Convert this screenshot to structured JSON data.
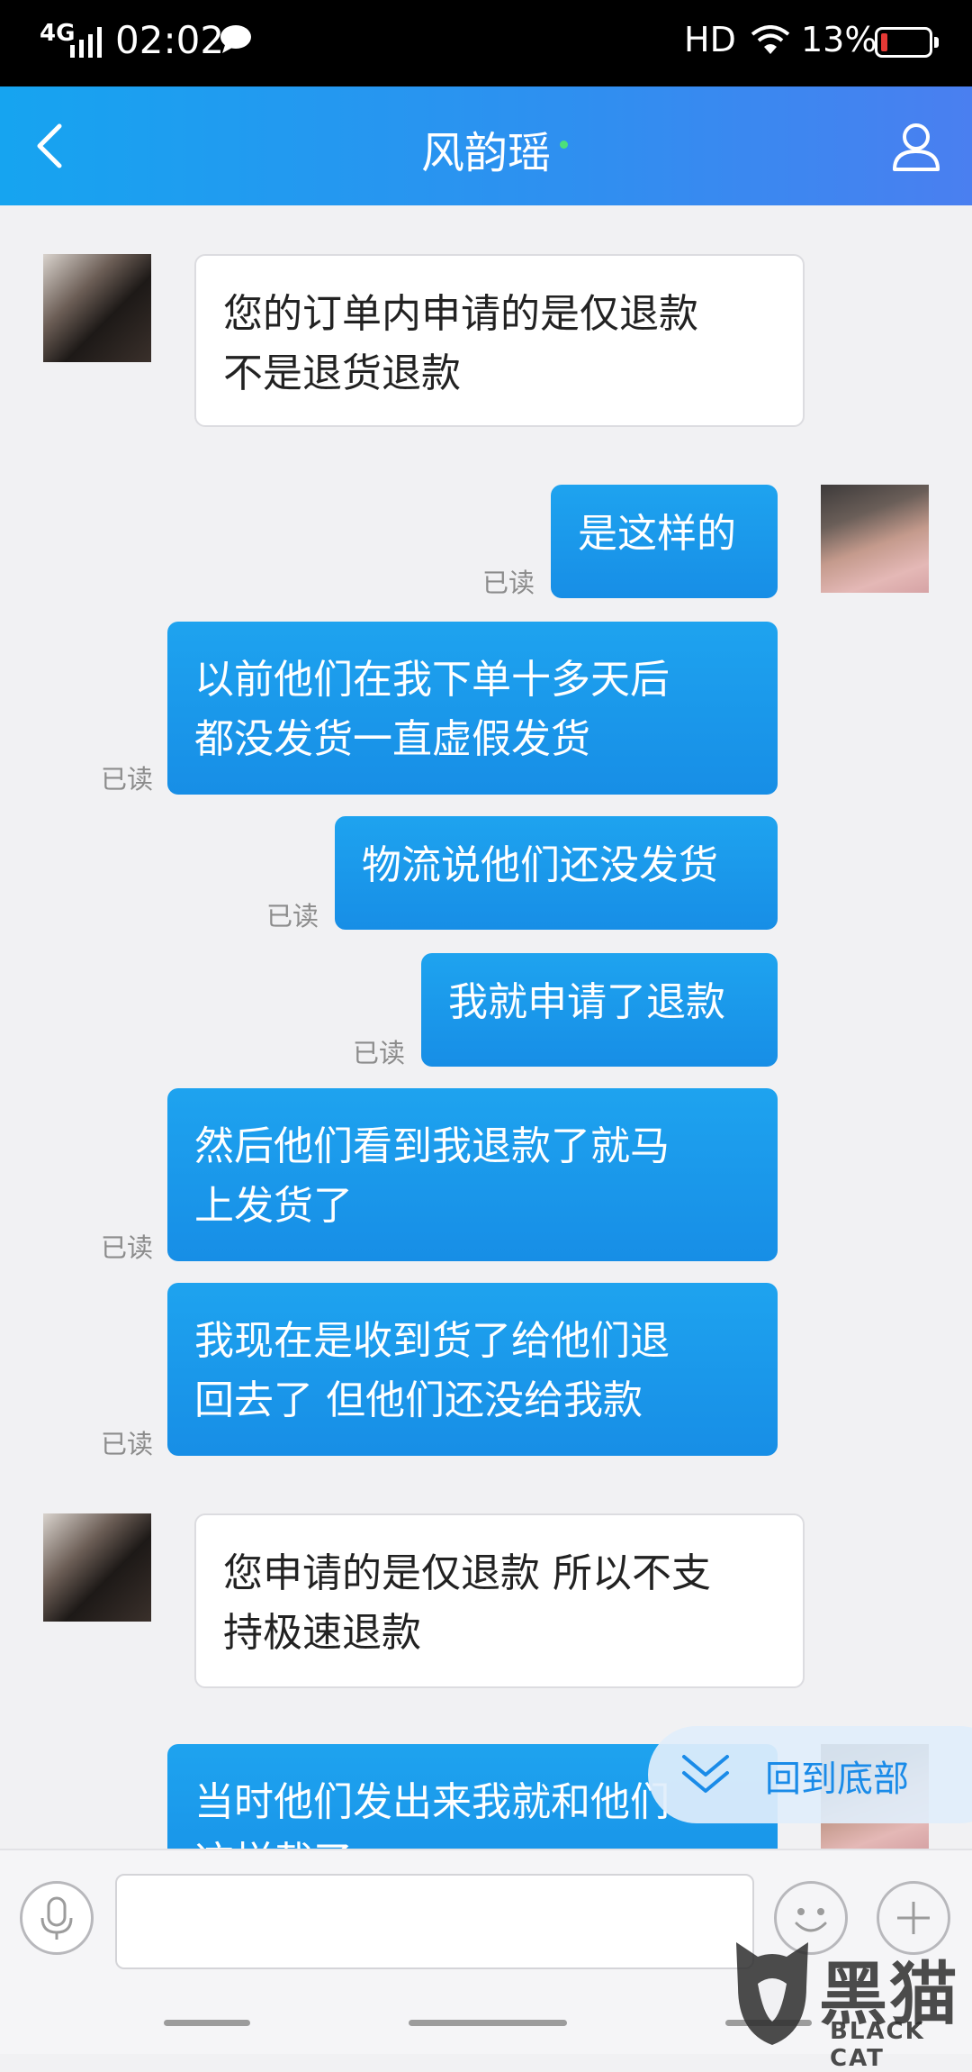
{
  "status_bar": {
    "network": "4G",
    "time": "02:02",
    "hd": "HD",
    "battery_text": "13%",
    "battery_level": 0.13
  },
  "header": {
    "title": "风韵瑶"
  },
  "messages": [
    {
      "side": "in",
      "text_line1": "您的订单内申请的是仅退款",
      "text_line2": "不是退货退款"
    },
    {
      "side": "out",
      "text": "是这样的",
      "read": "已读"
    },
    {
      "side": "out",
      "text_line1": "以前他们在我下单十多天后",
      "text_line2": "都没发货一直虚假发货",
      "read": "已读"
    },
    {
      "side": "out",
      "text": "物流说他们还没发货",
      "read": "已读"
    },
    {
      "side": "out",
      "text": "我就申请了退款",
      "read": "已读"
    },
    {
      "side": "out",
      "text_line1": "然后他们看到我退款了就马",
      "text_line2": "上发货了",
      "read": "已读"
    },
    {
      "side": "out",
      "text_line1": "我现在是收到货了给他们退",
      "text_line2": "回去了 但他们还没给我款",
      "read": "已读"
    },
    {
      "side": "in",
      "text_line1": "您申请的是仅退款 所以不支",
      "text_line2": "持极速退款"
    },
    {
      "side": "out",
      "text_line1": "当时他们发出来我就和他们",
      "text_line2": "这样截了"
    }
  ],
  "back_to_bottom": {
    "label": "回到底部"
  },
  "watermark": {
    "cn": "黑猫",
    "en": "BLACK CAT"
  },
  "icons": {
    "back": "chevron-left-icon",
    "profile": "person-icon",
    "mic": "microphone-icon",
    "emoji": "smiley-icon",
    "plus": "plus-icon",
    "down": "double-chevron-down-icon"
  }
}
